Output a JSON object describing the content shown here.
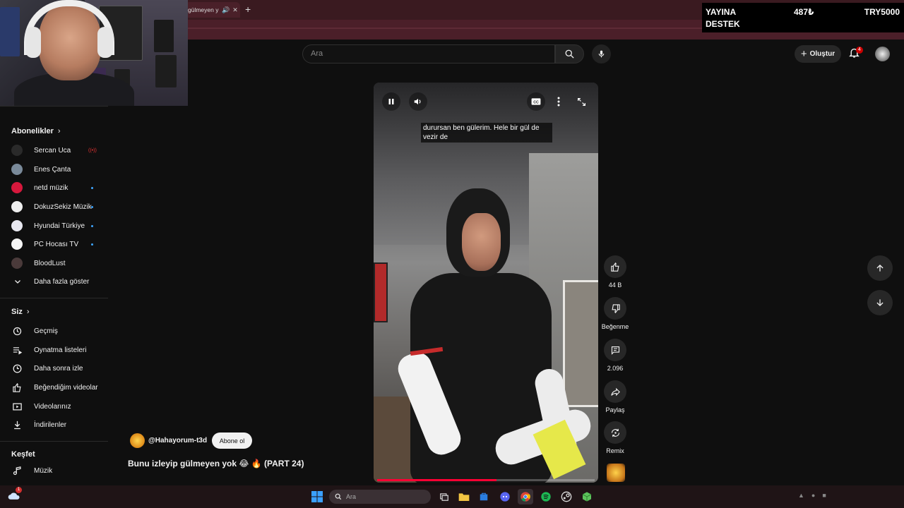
{
  "browser": {
    "tab_title": "gülmeyen y",
    "new_tab": "+"
  },
  "overlay": {
    "line1": "YAYINA",
    "line2": "DESTEK",
    "amount": "487₺",
    "currency": "TRY5000"
  },
  "header": {
    "search_placeholder": "Ara",
    "create_label": "Oluştur",
    "notification_count": "4"
  },
  "sidebar": {
    "subscriptions_title": "Abonelikler",
    "subscriptions": [
      {
        "label": "Sercan Uca",
        "status": "live-red",
        "color": "#2a2a2a"
      },
      {
        "label": "Enes Çanta",
        "status": "none",
        "color": "#7a8a9a"
      },
      {
        "label": "netd müzik",
        "status": "dot",
        "color": "#d6183c"
      },
      {
        "label": "DokuzSekiz Müzik",
        "status": "dot",
        "color": "#eeeeee"
      },
      {
        "label": "Hyundai Türkiye",
        "status": "dot",
        "color": "#e8e8f0"
      },
      {
        "label": "PC Hocası TV",
        "status": "dot",
        "color": "#f5f5f5"
      },
      {
        "label": "BloodLust",
        "status": "none",
        "color": "#4a3a3a"
      }
    ],
    "show_more": "Daha fazla göster",
    "you_title": "Siz",
    "you_items": [
      {
        "label": "Geçmiş",
        "icon": "history-icon"
      },
      {
        "label": "Oynatma listeleri",
        "icon": "playlists-icon"
      },
      {
        "label": "Daha sonra izle",
        "icon": "watch-later-icon"
      },
      {
        "label": "Beğendiğim videolar",
        "icon": "liked-icon"
      },
      {
        "label": "Videolarınız",
        "icon": "your-videos-icon"
      },
      {
        "label": "İndirilenler",
        "icon": "downloads-icon"
      }
    ],
    "explore_title": "Keşfet",
    "explore_items": [
      {
        "label": "Müzik",
        "icon": "music-icon"
      }
    ]
  },
  "player": {
    "caption": "durursan ben gülerim. Hele bir gül de vezir de",
    "progress": 0.55,
    "progress_color": "#ff0033"
  },
  "actions": {
    "like_count": "44 B",
    "dislike_label": "Beğenme",
    "comment_count": "2.096",
    "share_label": "Paylaş",
    "remix_label": "Remix"
  },
  "video": {
    "channel": "@Hahayorum-t3d",
    "subscribe_label": "Abone ol",
    "title": "Bunu izleyip gülmeyen yok 😂 🔥 (PART 24)"
  },
  "taskbar": {
    "search_placeholder": "Ara",
    "weather_badge": "1",
    "accent": "#0078d4"
  }
}
